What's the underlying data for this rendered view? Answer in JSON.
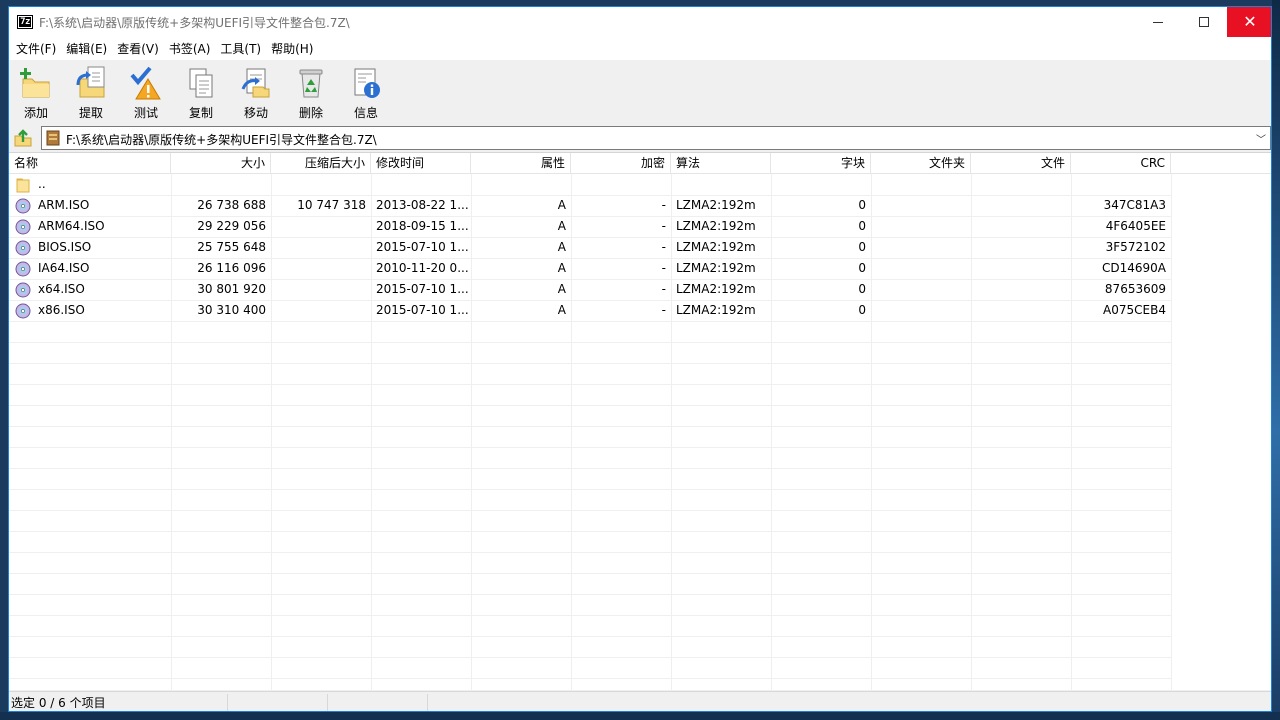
{
  "window": {
    "title": "F:\\系统\\启动器\\原版传统+多架构UEFI引导文件整合包.7Z\\",
    "app_icon_text": "7z"
  },
  "menu": [
    "文件(F)",
    "编辑(E)",
    "查看(V)",
    "书签(A)",
    "工具(T)",
    "帮助(H)"
  ],
  "toolbar": [
    {
      "label": "添加",
      "icon": "add-icon"
    },
    {
      "label": "提取",
      "icon": "extract-icon"
    },
    {
      "label": "测试",
      "icon": "test-icon"
    },
    {
      "label": "复制",
      "icon": "copy-icon"
    },
    {
      "label": "移动",
      "icon": "move-icon"
    },
    {
      "label": "删除",
      "icon": "delete-icon"
    },
    {
      "label": "信息",
      "icon": "info-icon"
    }
  ],
  "address": {
    "path": "F:\\系统\\启动器\\原版传统+多架构UEFI引导文件整合包.7Z\\"
  },
  "columns": [
    "名称",
    "大小",
    "压缩后大小",
    "修改时间",
    "属性",
    "加密",
    "算法",
    "字块",
    "文件夹",
    "文件",
    "CRC"
  ],
  "rows": [
    {
      "name": "..",
      "size": "",
      "packed": "",
      "modified": "",
      "attr": "",
      "encrypted": "",
      "method": "",
      "block": "",
      "folders": "",
      "files": "",
      "crc": "",
      "type": "folder"
    },
    {
      "name": "ARM.ISO",
      "size": "26 738 688",
      "packed": "10 747 318",
      "modified": "2013-08-22 1...",
      "attr": "A",
      "encrypted": "-",
      "method": "LZMA2:192m",
      "block": "0",
      "folders": "",
      "files": "",
      "crc": "347C81A3",
      "type": "iso"
    },
    {
      "name": "ARM64.ISO",
      "size": "29 229 056",
      "packed": "",
      "modified": "2018-09-15 1...",
      "attr": "A",
      "encrypted": "-",
      "method": "LZMA2:192m",
      "block": "0",
      "folders": "",
      "files": "",
      "crc": "4F6405EE",
      "type": "iso"
    },
    {
      "name": "BIOS.ISO",
      "size": "25 755 648",
      "packed": "",
      "modified": "2015-07-10 1...",
      "attr": "A",
      "encrypted": "-",
      "method": "LZMA2:192m",
      "block": "0",
      "folders": "",
      "files": "",
      "crc": "3F572102",
      "type": "iso"
    },
    {
      "name": "IA64.ISO",
      "size": "26 116 096",
      "packed": "",
      "modified": "2010-11-20 0...",
      "attr": "A",
      "encrypted": "-",
      "method": "LZMA2:192m",
      "block": "0",
      "folders": "",
      "files": "",
      "crc": "CD14690A",
      "type": "iso"
    },
    {
      "name": "x64.ISO",
      "size": "30 801 920",
      "packed": "",
      "modified": "2015-07-10 1...",
      "attr": "A",
      "encrypted": "-",
      "method": "LZMA2:192m",
      "block": "0",
      "folders": "",
      "files": "",
      "crc": "87653609",
      "type": "iso"
    },
    {
      "name": "x86.ISO",
      "size": "30 310 400",
      "packed": "",
      "modified": "2015-07-10 1...",
      "attr": "A",
      "encrypted": "-",
      "method": "LZMA2:192m",
      "block": "0",
      "folders": "",
      "files": "",
      "crc": "A075CEB4",
      "type": "iso"
    }
  ],
  "status": {
    "selection": "选定 0 / 6 个项目",
    "seg2": "",
    "seg3": ""
  }
}
